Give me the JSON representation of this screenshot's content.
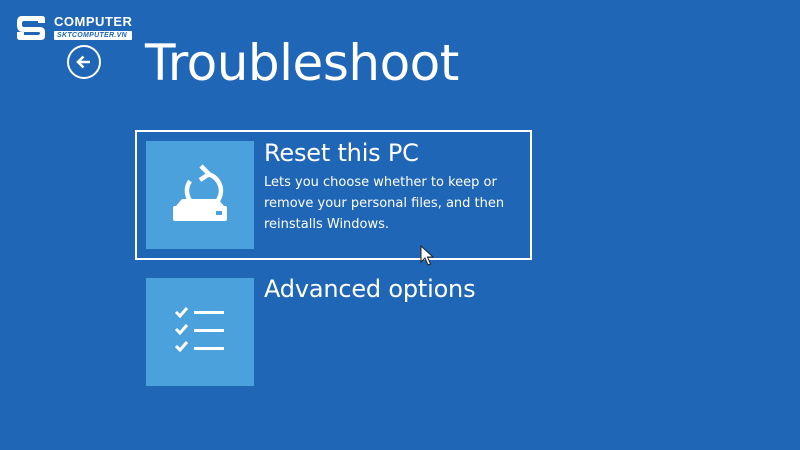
{
  "watermark": {
    "brand": "COMPUTER",
    "domain": "SKTCOMPUTER.VN"
  },
  "header": {
    "title": "Troubleshoot",
    "back_icon": "back-arrow-icon"
  },
  "options": [
    {
      "title": "Reset this PC",
      "description": "Lets you choose whether to keep or remove your personal files, and then reinstalls Windows.",
      "icon": "reset-pc-icon",
      "selected": true
    },
    {
      "title": "Advanced options",
      "description": "",
      "icon": "checklist-icon",
      "selected": false
    }
  ],
  "colors": {
    "background": "#1f66b6",
    "tile": "#4aa1dc",
    "text": "#ffffff"
  }
}
